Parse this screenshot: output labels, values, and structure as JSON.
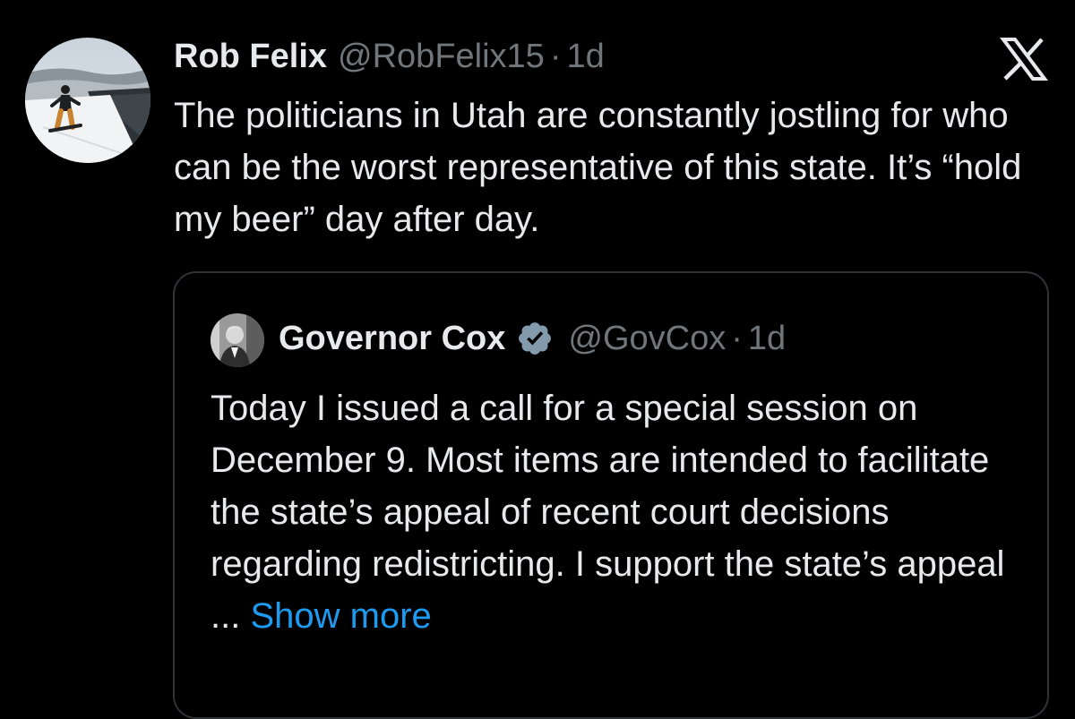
{
  "tweet": {
    "author": {
      "display_name": "Rob Felix",
      "handle": "@RobFelix15",
      "separator": "·",
      "time": "1d",
      "avatar_icon": "snowboarder-avatar"
    },
    "text": "The politicians in Utah are constantly jostling for who can be the worst representative of this state. It’s “hold my beer” day after day.",
    "platform_icon": "x-logo-icon"
  },
  "quoted_tweet": {
    "author": {
      "display_name": "Governor Cox",
      "verified_icon": "verified-badge-icon",
      "handle": "@GovCox",
      "separator": "·",
      "time": "1d",
      "avatar_icon": "governor-avatar"
    },
    "text": "Today I issued a call for a special session on December 9. Most items are intended to facilitate the state’s appeal of recent court decisions regarding redistricting. I support the state’s appeal ... ",
    "show_more_label": "Show more"
  },
  "colors": {
    "background": "#000000",
    "primary_text": "#e7e9ea",
    "secondary_text": "#71767b",
    "link": "#1d9bf0",
    "border": "#2f3336",
    "verified": "#829aab"
  }
}
